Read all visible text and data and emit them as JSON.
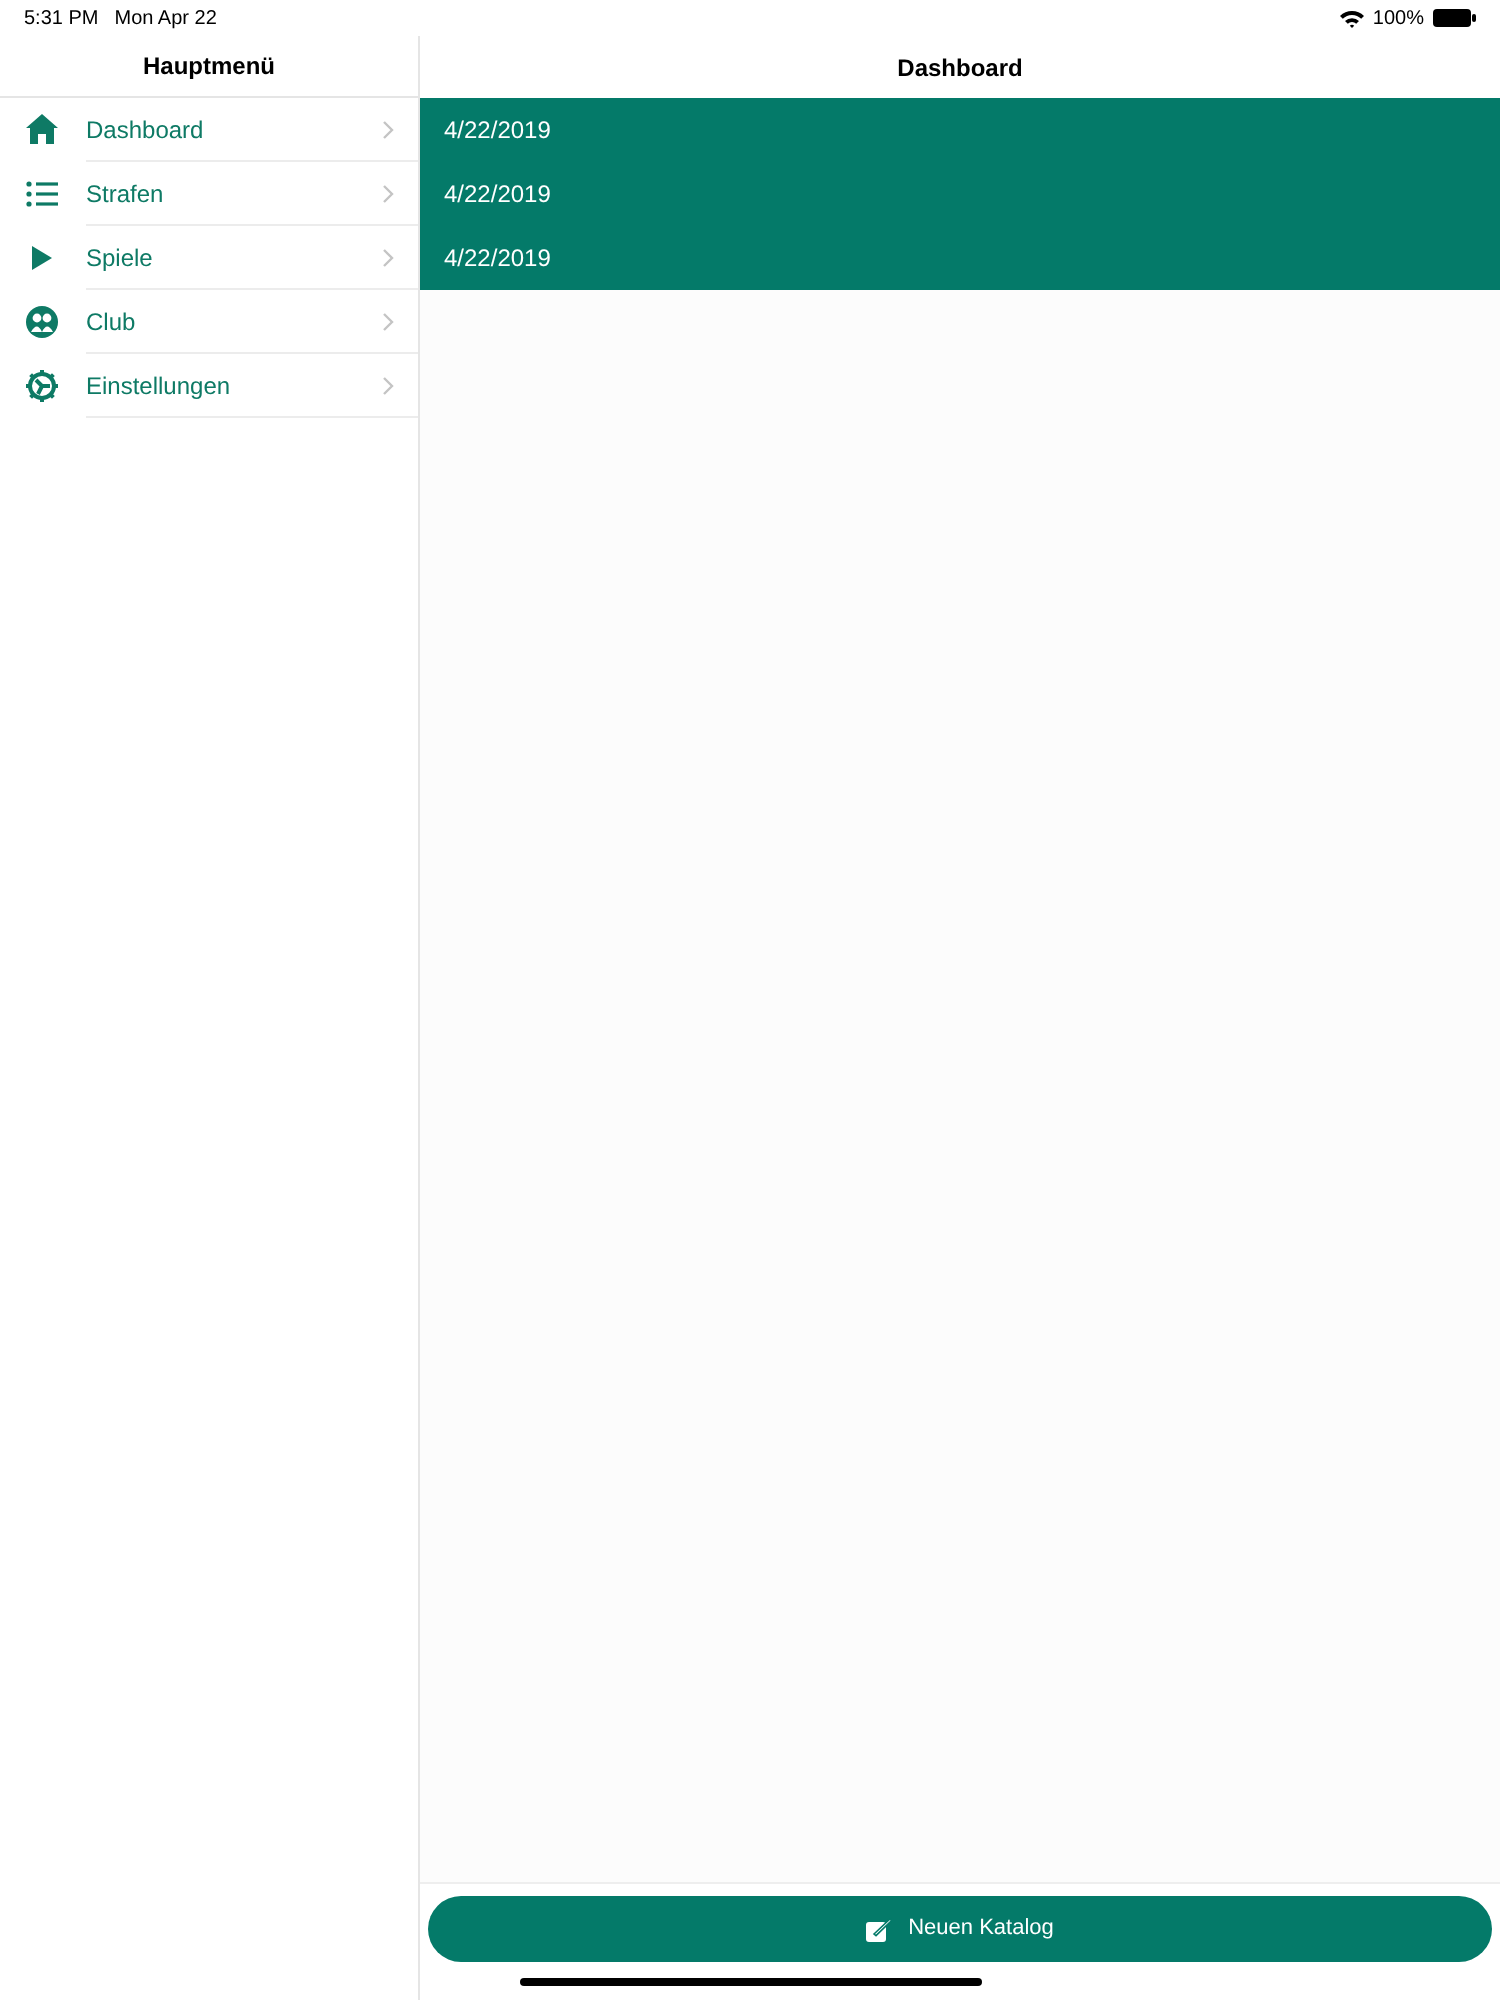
{
  "status_bar": {
    "time": "5:31 PM",
    "date": "Mon Apr 22",
    "battery": "100%"
  },
  "sidebar": {
    "title": "Hauptmenü",
    "items": [
      {
        "label": "Dashboard"
      },
      {
        "label": "Strafen"
      },
      {
        "label": "Spiele"
      },
      {
        "label": "Club"
      },
      {
        "label": "Einstellungen"
      }
    ]
  },
  "main": {
    "title": "Dashboard",
    "rows": [
      {
        "text": "4/22/2019"
      },
      {
        "text": "4/22/2019"
      },
      {
        "text": "4/22/2019"
      }
    ],
    "button": {
      "label": "Neuen Katalog"
    }
  }
}
